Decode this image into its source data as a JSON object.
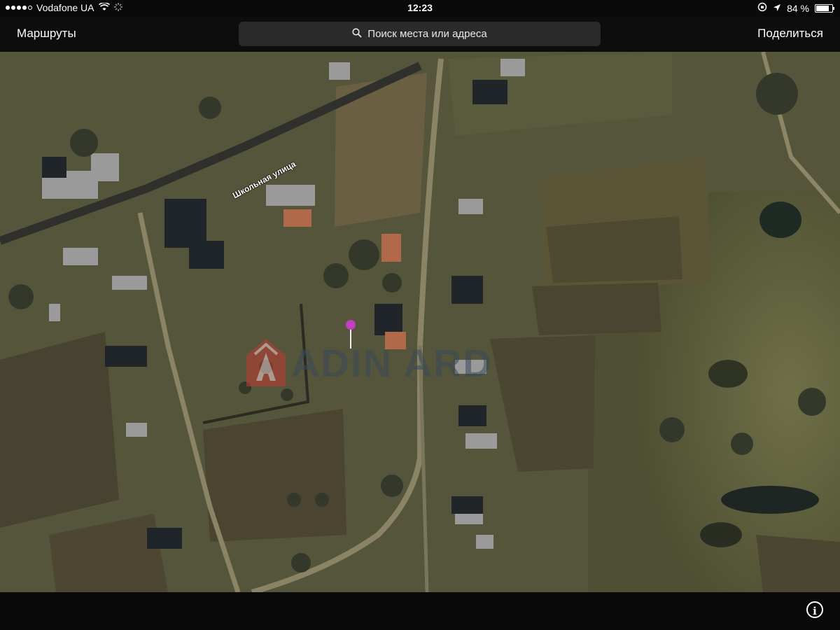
{
  "status_bar": {
    "carrier": "Vodafone UA",
    "time": "12:23",
    "battery_percent": "84 %",
    "battery_level": 0.84,
    "icons": [
      "signal-dots-icon",
      "wifi-icon",
      "activity-icon",
      "rotation-lock-icon",
      "location-arrow-icon",
      "battery-icon"
    ]
  },
  "nav": {
    "left_label": "Маршруты",
    "search_placeholder": "Поиск места или адреса",
    "right_label": "Поделиться"
  },
  "map": {
    "street_label": "Школьная улица",
    "watermark_text": "ADIN ARD",
    "pin_color": "#c040c0"
  },
  "bottom_bar": {
    "info_icon": "info-icon",
    "info_glyph": "i"
  },
  "colors": {
    "bar_background": "#0a0a0a",
    "search_background": "#2a2a2a",
    "watermark_red": "#c23b34"
  }
}
